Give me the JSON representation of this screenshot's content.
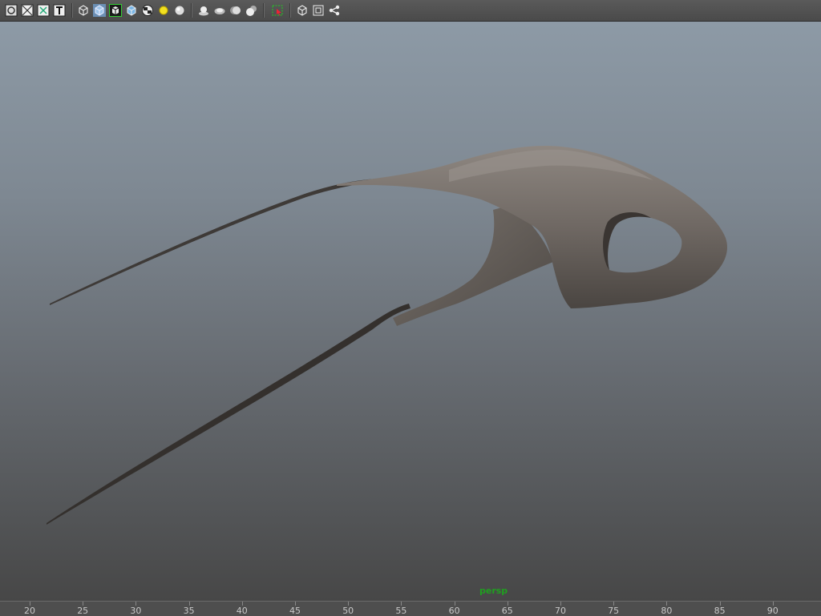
{
  "toolbar": {
    "buttons": [
      {
        "icon": "isolate-select-icon"
      },
      {
        "icon": "wireframe-cross-icon"
      },
      {
        "icon": "smooth-shade-icon"
      },
      {
        "icon": "texture-text-icon"
      },
      {
        "icon": "wireframe-cube-icon"
      },
      {
        "icon": "shaded-cube-icon"
      },
      {
        "icon": "wireframe-on-shaded-icon"
      },
      {
        "icon": "textured-cube-icon"
      },
      {
        "icon": "checker-texture-icon"
      },
      {
        "icon": "default-lighting-icon"
      },
      {
        "icon": "shaded-sphere-icon"
      },
      {
        "icon": "shadows-icon"
      },
      {
        "icon": "screen-space-ao-icon"
      },
      {
        "icon": "motion-blur-icon"
      },
      {
        "icon": "anti-aliasing-icon"
      },
      {
        "icon": "select-camera-icon"
      },
      {
        "icon": "xray-cube-icon"
      },
      {
        "icon": "resolution-gate-icon"
      },
      {
        "icon": "share-graph-icon"
      }
    ]
  },
  "viewport": {
    "camera_label": "persp"
  },
  "timeline": {
    "ticks": [
      "20",
      "25",
      "30",
      "35",
      "40",
      "45",
      "50",
      "55",
      "60",
      "65",
      "70",
      "75",
      "80",
      "85",
      "90"
    ]
  }
}
